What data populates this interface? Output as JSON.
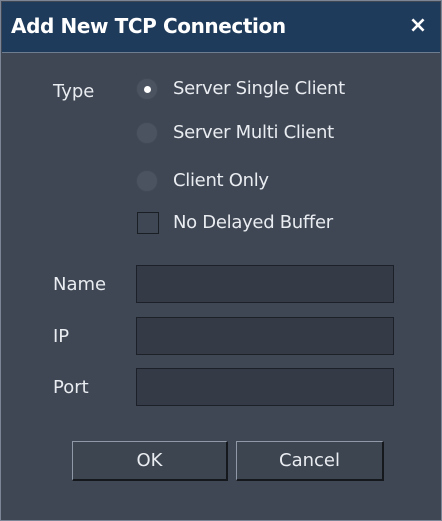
{
  "dialog": {
    "title": "Add New TCP Connection",
    "close_label": "×"
  },
  "type": {
    "label": "Type",
    "options": [
      {
        "label": "Server Single Client",
        "selected": true
      },
      {
        "label": "Server Multi Client",
        "selected": false
      },
      {
        "label": "Client Only",
        "selected": false
      }
    ],
    "no_delayed_buffer": {
      "label": "No Delayed Buffer",
      "checked": false
    }
  },
  "fields": {
    "name": {
      "label": "Name",
      "value": ""
    },
    "ip": {
      "label": "IP",
      "value": ""
    },
    "port": {
      "label": "Port",
      "value": ""
    }
  },
  "buttons": {
    "ok": "OK",
    "cancel": "Cancel"
  },
  "colors": {
    "title_bar": "#1f3b5c",
    "panel": "#3f4754",
    "field_bg": "#343b46"
  }
}
